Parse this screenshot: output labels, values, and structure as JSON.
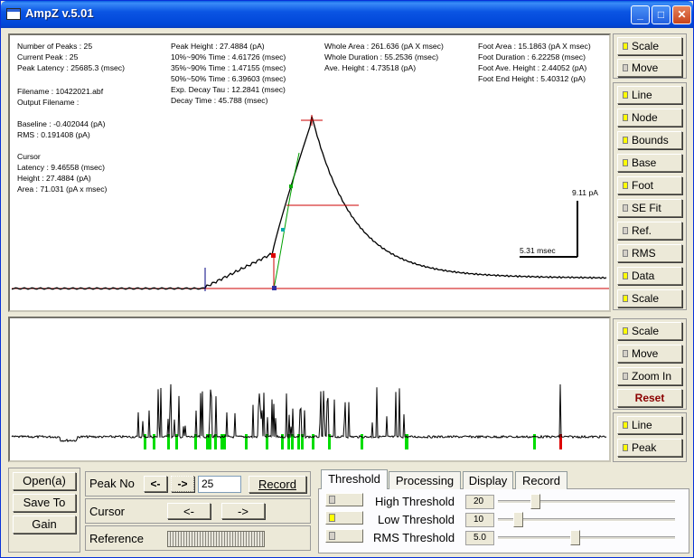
{
  "window": {
    "title": "AmpZ v.5.01",
    "minimize_icon": "minimize-icon",
    "maximize_icon": "maximize-icon",
    "close_icon": "close-icon"
  },
  "info": {
    "col1_a": "Number of Peaks : 25\nCurrent Peak : 25\nPeak Latency : 25685.3 (msec)",
    "col1_b": "Filename : 10422021.abf\nOutput Filename :",
    "col1_c": "Baseline : -0.402044 (pA)\nRMS : 0.191408 (pA)",
    "col1_d": "Cursor\nLatency : 9.46558 (msec)\nHeight : 27.4884 (pA)\nArea : 71.031 (pA x msec)",
    "col2": "Peak Height : 27.4884 (pA)\n10%~90% Time : 4.61726 (msec)\n35%~90% Time : 1.47155 (msec)\n50%~50% Time : 6.39603 (msec)\nExp. Decay Tau : 12.2841 (msec)\nDecay Time : 45.788 (msec)",
    "col3": "Whole Area : 261.636 (pA X msec)\nWhole Duration : 55.2536 (msec)\nAve. Height : 4.73518 (pA)",
    "col4": "Foot Area : 15.1863 (pA X msec)\nFoot Duration : 6.22258 (msec)\nFoot Ave. Height : 2.44052 (pA)\nFoot End Height : 5.40312 (pA)"
  },
  "scalebar": {
    "y_label": "9.11 pA",
    "x_label": "5.31 msec"
  },
  "side_top": {
    "scale": "Scale",
    "move": "Move",
    "line": "Line",
    "node": "Node",
    "bounds": "Bounds",
    "base": "Base",
    "foot": "Foot",
    "sefit": "SE Fit",
    "ref": "Ref.",
    "rms": "RMS",
    "data": "Data",
    "scale2": "Scale"
  },
  "side_bottom": {
    "scale": "Scale",
    "move": "Move",
    "zoom": "Zoom In",
    "reset": "Reset",
    "line": "Line",
    "peak": "Peak"
  },
  "file_buttons": {
    "open": "Open(a)",
    "save": "Save To",
    "gain": "Gain"
  },
  "peak_panel": {
    "peak_no_label": "Peak No",
    "prev": "<-",
    "next": "->",
    "peak_value": "25",
    "record": "Record",
    "cursor_label": "Cursor",
    "cursor_left": "<-",
    "cursor_right": "->",
    "reference_label": "Reference"
  },
  "tabs": [
    "Threshold",
    "Processing",
    "Display",
    "Record"
  ],
  "threshold": {
    "high_label": "High Threshold",
    "high_value": "20",
    "low_label": "Low Threshold",
    "low_value": "10",
    "rms_label": "RMS Threshold",
    "rms_value": "5.0"
  },
  "colors": {
    "accent_yellow": "#ffff00",
    "reset_red": "#8b0000",
    "baseline_red": "#cc0000",
    "fit_green": "#00aa00",
    "peak_green": "#00dd00"
  }
}
